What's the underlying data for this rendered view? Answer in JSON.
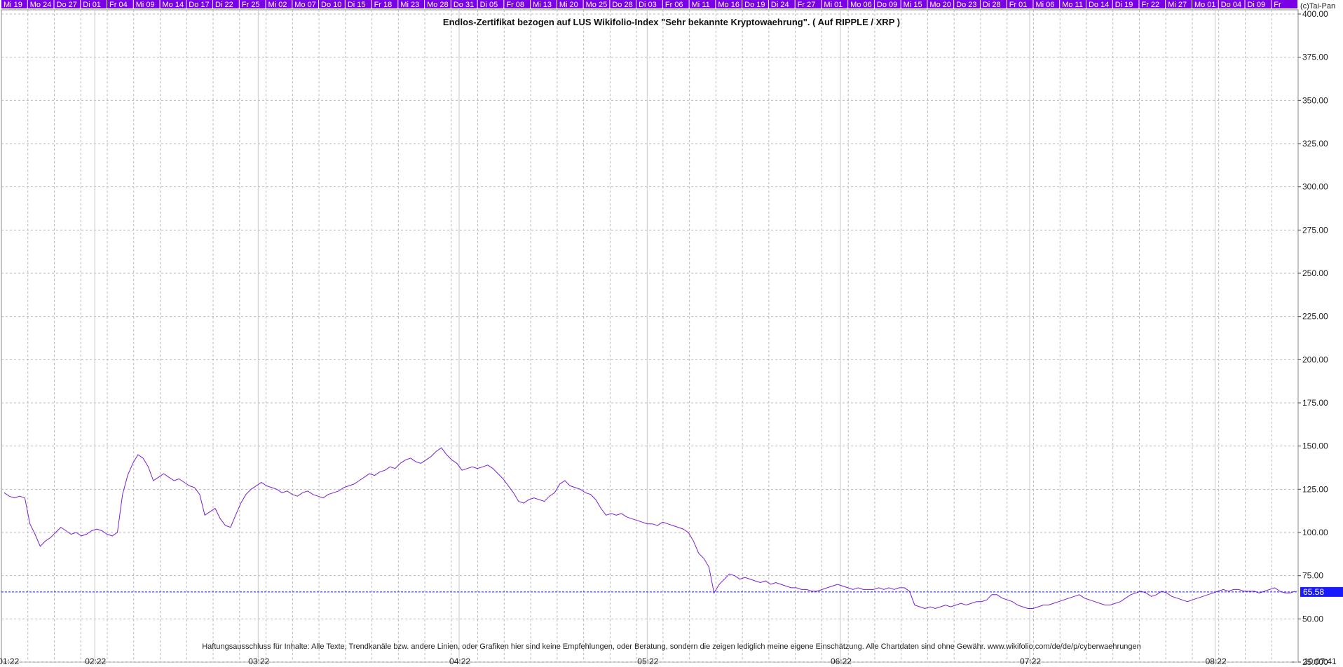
{
  "chart_data": {
    "type": "line",
    "title": "Endlos-Zertifikat bezogen auf LUS Wikifolio-Index \"Sehr bekannte Kryptowaehrung\". ( Auf RIPPLE / XRP )",
    "copyright": "(c)Tai-Pan",
    "footnote": "Haftungsausschluss für Inhalte: Alle Texte, Trendkanäle bzw. andere Linien, oder Grafiken hier sind keine Empfehlungen, oder Beratung, sondern die zeigen lediglich meine eigene Einschätzung. Alle Chartdaten sind ohne Gewähr.  www.wikifolio.com/de/de/p/cyberwaehrungen",
    "ylim": [
      25,
      400
    ],
    "yticks": [
      "400.00",
      "375.00",
      "350.00",
      "325.00",
      "300.00",
      "275.00",
      "250.00",
      "225.00",
      "200.00",
      "175.00",
      "150.00",
      "125.00",
      "100.00",
      "75.00",
      "50.00",
      "25.000"
    ],
    "grid": true,
    "current_value": 65.58,
    "current_label": "65.58",
    "time_label": "10:07:41",
    "dash_label": "-",
    "month_labels": [
      "01:22",
      "02:22",
      "03:22",
      "04:22",
      "05:22",
      "06:22",
      "07:22",
      "08:22"
    ],
    "day_labels": [
      "Mi 19",
      "Mo 24",
      "Do 27",
      "Di 01",
      "Fr 04",
      "Mi 09",
      "Mo 14",
      "Do 17",
      "Di 22",
      "Fr 25",
      "Mi 02",
      "Mo 07",
      "Do 10",
      "Di 15",
      "Fr 18",
      "Mi 23",
      "Mo 28",
      "Do 31",
      "Di 05",
      "Fr 08",
      "Mi 13",
      "Mi 20",
      "Mo 25",
      "Do 28",
      "Di 03",
      "Fr 06",
      "Mi 11",
      "Mo 16",
      "Do 19",
      "Di 24",
      "Fr 27",
      "Mi 01",
      "Mo 06",
      "Do 09",
      "Mi 15",
      "Mo 20",
      "Do 23",
      "Di 28",
      "Fr 01",
      "Mi 06",
      "Mo 11",
      "Do 14",
      "Di 19",
      "Fr 22",
      "Mi 27",
      "Mo 01",
      "Do 04",
      "Di 09",
      "Fr"
    ],
    "series": [
      {
        "color": "#7b1fd1",
        "values": [
          123,
          121,
          120,
          121,
          120,
          105,
          99,
          92,
          95,
          97,
          100,
          103,
          101,
          99,
          100,
          98,
          99,
          101,
          102,
          101,
          99,
          98,
          100,
          122,
          133,
          140,
          145,
          143,
          138,
          130,
          132,
          134,
          132,
          130,
          131,
          129,
          127,
          126,
          122,
          110,
          112,
          114,
          108,
          104,
          103,
          110,
          117,
          122,
          125,
          127,
          129,
          127,
          126,
          125,
          123,
          124,
          122,
          121,
          123,
          124,
          122,
          121,
          120,
          122,
          123,
          124,
          126,
          127,
          128,
          130,
          132,
          134,
          133,
          135,
          136,
          138,
          137,
          140,
          142,
          143,
          141,
          140,
          142,
          144,
          147,
          149,
          145,
          142,
          140,
          136,
          137,
          138,
          137,
          138,
          139,
          137,
          134,
          131,
          127,
          123,
          118,
          117,
          119,
          120,
          119,
          118,
          121,
          123,
          128,
          130,
          127,
          126,
          125,
          123,
          122,
          119,
          114,
          110,
          111,
          110,
          111,
          109,
          108,
          107,
          106,
          105,
          105,
          104,
          106,
          105,
          104,
          103,
          102,
          100,
          95,
          88,
          85,
          80,
          65,
          70,
          73,
          76,
          75,
          73,
          74,
          73,
          72,
          71,
          72,
          70,
          71,
          70,
          69,
          68,
          68,
          67,
          67,
          66,
          66,
          67,
          68,
          69,
          70,
          69,
          68,
          67,
          68,
          67,
          67,
          67,
          68,
          67,
          68,
          67,
          68,
          68,
          66,
          58,
          57,
          56,
          57,
          56,
          57,
          58,
          57,
          58,
          59,
          58,
          59,
          60,
          60,
          61,
          64,
          64,
          62,
          61,
          60,
          58,
          57,
          56,
          56,
          57,
          58,
          58,
          59,
          60,
          61,
          62,
          63,
          64,
          62,
          61,
          60,
          59,
          58,
          58,
          59,
          60,
          62,
          64,
          65,
          66,
          65,
          63,
          64,
          66,
          65,
          63,
          62,
          61,
          60,
          61,
          62,
          63,
          64,
          65,
          66,
          67,
          66,
          67,
          67,
          66,
          66,
          66,
          65,
          66,
          67,
          68,
          66,
          65,
          65,
          66
        ]
      }
    ]
  }
}
